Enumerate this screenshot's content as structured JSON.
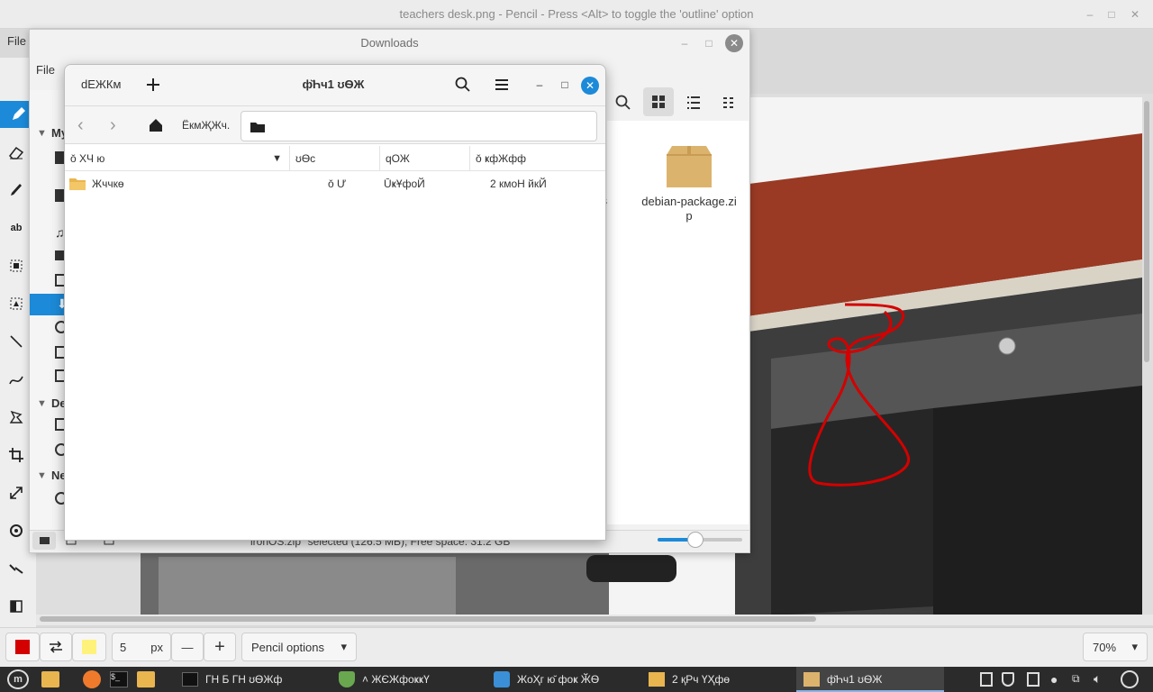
{
  "main_window": {
    "title": "teachers desk.png - Pencil - Press <Alt> to toggle the 'outline' option",
    "menu_label": "File"
  },
  "left_tools": [
    "pencil-icon",
    "eraser-icon",
    "brush-icon",
    "text-icon",
    "select-rect-icon",
    "select-free-icon",
    "line-icon",
    "curve-icon",
    "fill-icon",
    "crop-icon",
    "scale-icon",
    "rotate-icon",
    "skew-icon",
    "filters-icon"
  ],
  "bottom_bar": {
    "main_color": "#d40000",
    "secondary_color": "#fff27a",
    "size_value": "5",
    "size_unit": "px",
    "options_label": "Pencil options",
    "zoom_value": "70%"
  },
  "downloads_window": {
    "title": "Downloads",
    "menu_label": "File",
    "sidebar_section_my": "My",
    "sidebar_section_devices": "De",
    "sidebar_section_network": "Ne",
    "file_item_label": "debian-package.zip",
    "file_item_partial": "s",
    "status_text": "ironOS.zip\" selected (126.5 MB), Free space: 31.2 GB",
    "zoom_slider_fraction": 0.45
  },
  "chooser_dialog": {
    "cancel_label": "dЕЖКм",
    "title": "ф̆Һч1 ʊѲЖ",
    "path_label": "ЁкмҖЖч.",
    "columns": {
      "name": "ǒ ХЧ ю",
      "size": "ʊѲс",
      "type": "qОЖ",
      "modified": "ǒ ҝфЖфф"
    },
    "rows": [
      {
        "name": "Жччкө",
        "size": "ǒ Ư",
        "type": "ŪҝҰфоЙ",
        "modified": "2 кмоН йкЙ"
      }
    ]
  },
  "taskbar": {
    "items": [
      {
        "label": "ГН  Б ГН  ʊѲЖф"
      },
      {
        "label": "˄ ЖЄЖфоҝҝҮ"
      },
      {
        "label": "ЖоҲг ю̆ фоҝ ӁѲ"
      },
      {
        "label": "2 қРч ҮҲфө"
      },
      {
        "label": "ф̆Һч1 ʊѲЖ"
      }
    ]
  }
}
